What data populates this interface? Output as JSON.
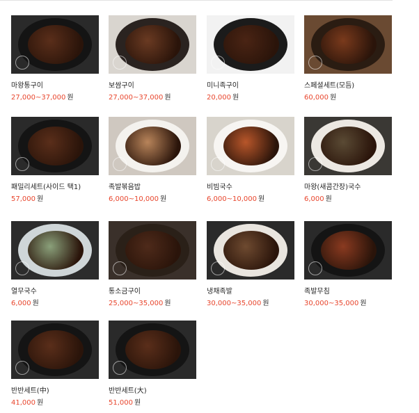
{
  "currency_unit": "원",
  "items": [
    {
      "name": "마왕통구이",
      "price": "27,000~37,000",
      "bg": "#2a2a2a",
      "plate": "#141414",
      "food": "#5a2e1a"
    },
    {
      "name": "보쌈구이",
      "price": "27,000~37,000",
      "bg": "#d9d5cf",
      "plate": "#2a2320",
      "food": "#6a3a22"
    },
    {
      "name": "미니족구이",
      "price": "20,000",
      "bg": "#f2f2f2",
      "plate": "#1b1b1b",
      "food": "#4a2414"
    },
    {
      "name": "스페셜세트(모듬)",
      "price": "60,000",
      "bg": "#6a4a32",
      "plate": "#2a1c12",
      "food": "#7a3a1c"
    },
    {
      "name": "패밀리세트(사이드 택1)",
      "price": "57,000",
      "bg": "#2a2a2a",
      "plate": "#141414",
      "food": "#5a2e1a"
    },
    {
      "name": "족발볶음밥",
      "price": "6,000~10,000",
      "bg": "#cfc8c0",
      "plate": "#f4f2ee",
      "food": "#b8845a"
    },
    {
      "name": "비빔국수",
      "price": "6,000~10,000",
      "bg": "#d8d4cc",
      "plate": "#f7f5f2",
      "food": "#b8562a"
    },
    {
      "name": "마왕(새콤간장)국수",
      "price": "6,000",
      "bg": "#3a3834",
      "plate": "#ece8e2",
      "food": "#5a4a34"
    },
    {
      "name": "열무국수",
      "price": "6,000",
      "bg": "#2c2c2c",
      "plate": "#cfd6d8",
      "food": "#8aa07a"
    },
    {
      "name": "통소금구이",
      "price": "25,000~35,000",
      "bg": "#3a302a",
      "plate": "#2a2018",
      "food": "#4e2a1a"
    },
    {
      "name": "냉채족발",
      "price": "30,000~35,000",
      "bg": "#2a2a2a",
      "plate": "#e9e5df",
      "food": "#6e4a30"
    },
    {
      "name": "족발무침",
      "price": "30,000~35,000",
      "bg": "#2a2a2a",
      "plate": "#141414",
      "food": "#8a3a20"
    },
    {
      "name": "반반세트(中)",
      "price": "41,000",
      "bg": "#2a2a2a",
      "plate": "#141414",
      "food": "#5a2e1a"
    },
    {
      "name": "반반세트(大)",
      "price": "51,000",
      "bg": "#2a2a2a",
      "plate": "#141414",
      "food": "#5a2e1a"
    }
  ]
}
